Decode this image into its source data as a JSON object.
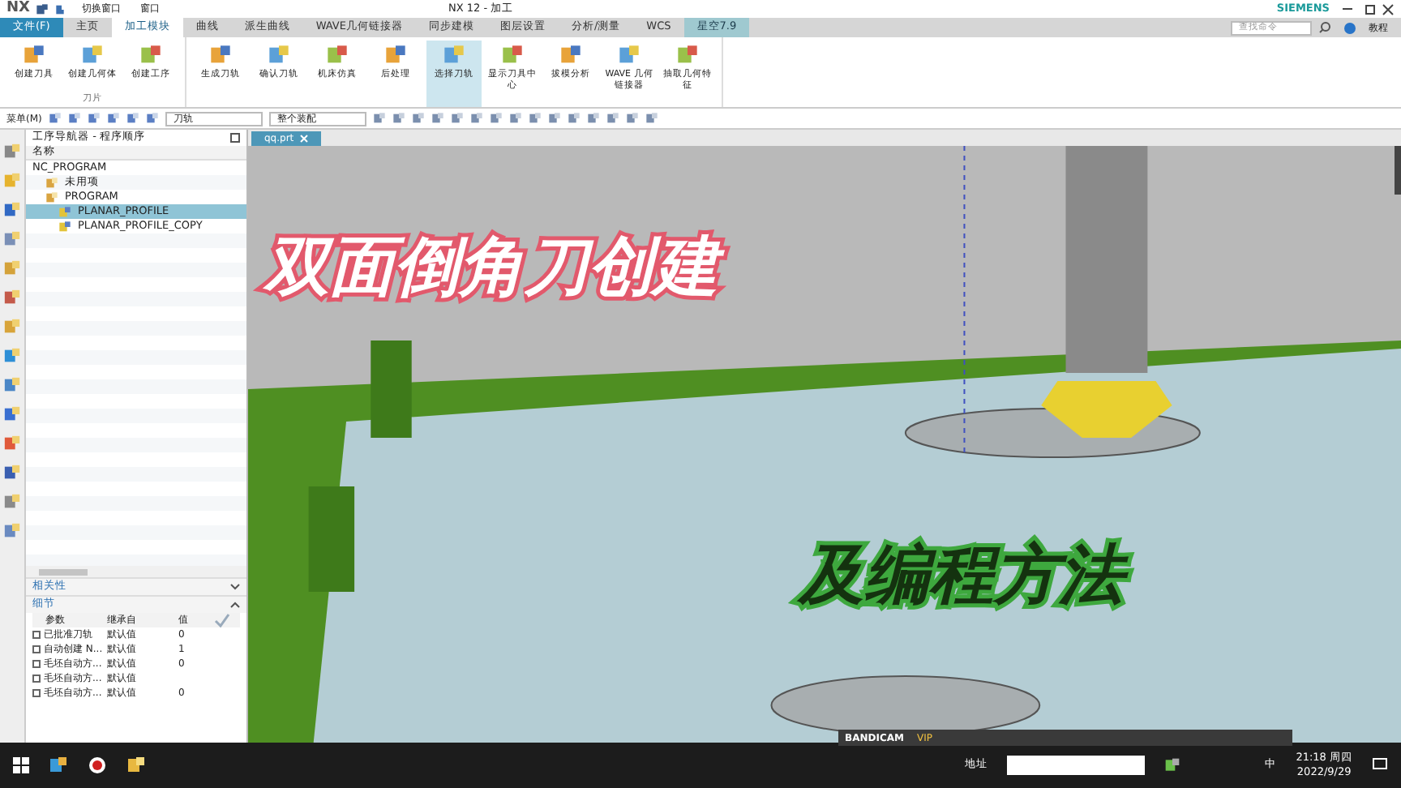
{
  "title_bar": {
    "app": "NX",
    "quick_access": [
      "切换窗口",
      "窗口"
    ],
    "title": "NX 12 - 加工",
    "brand": "SIEMENS"
  },
  "ribbon_tabs": [
    {
      "label": "文件(F)",
      "kind": "file",
      "selected": false
    },
    {
      "label": "主页",
      "kind": "tab",
      "selected": false
    },
    {
      "label": "加工模块",
      "kind": "tab",
      "selected": true
    },
    {
      "label": "曲线",
      "kind": "tab",
      "selected": false
    },
    {
      "label": "派生曲线",
      "kind": "tab",
      "selected": false
    },
    {
      "label": "WAVE几何链接器",
      "kind": "tab",
      "selected": false
    },
    {
      "label": "同步建模",
      "kind": "tab",
      "selected": false
    },
    {
      "label": "图层设置",
      "kind": "tab",
      "selected": false
    },
    {
      "label": "分析/测量",
      "kind": "tab",
      "selected": false
    },
    {
      "label": "WCS",
      "kind": "tab",
      "selected": false
    },
    {
      "label": "星空7.9",
      "kind": "plugin",
      "selected": false
    }
  ],
  "command_search": {
    "placeholder": "查找命令"
  },
  "help_label": "教程",
  "ribbon_groups": [
    {
      "label": "刀片",
      "buttons": [
        {
          "label": "创建刀具",
          "selected": false
        },
        {
          "label": "创建几何体",
          "selected": false
        },
        {
          "label": "创建工序",
          "selected": false
        }
      ]
    },
    {
      "buttons": [
        {
          "label": "生成刀轨",
          "selected": false
        },
        {
          "label": "确认刀轨",
          "selected": false
        },
        {
          "label": "机床仿真",
          "selected": false
        },
        {
          "label": "后处理",
          "selected": false
        },
        {
          "label": "选择刀轨",
          "selected": true
        },
        {
          "label": "显示刀具中心",
          "selected": false
        },
        {
          "label": "拔模分析",
          "selected": false
        },
        {
          "label": "WAVE 几何链接器",
          "selected": false
        },
        {
          "label": "抽取几何特征",
          "selected": false
        }
      ]
    }
  ],
  "toolbar": {
    "menu": "菜单(M)",
    "filter": "刀轨",
    "scope": "整个装配"
  },
  "navigator": {
    "title": "工序导航器 - 程序顺序",
    "column": "名称",
    "tree": [
      {
        "label": "NC_PROGRAM",
        "selected": false,
        "children": [
          {
            "label": "未用项",
            "kind": "group",
            "selected": false
          },
          {
            "label": "PROGRAM",
            "kind": "group",
            "selected": false,
            "children": [
              {
                "label": "PLANAR_PROFILE",
                "kind": "operation",
                "selected": true
              },
              {
                "label": "PLANAR_PROFILE_COPY",
                "kind": "operation",
                "selected": false
              }
            ]
          }
        ]
      }
    ]
  },
  "panels": [
    {
      "label": "相关性",
      "expanded": false
    },
    {
      "label": "细节",
      "expanded": true
    }
  ],
  "details": {
    "columns": [
      "参数",
      "继承自",
      "值"
    ],
    "rows": [
      {
        "param": "已批准刀轨",
        "from": "默认值",
        "value": "0"
      },
      {
        "param": "自动创建 N...",
        "from": "默认值",
        "value": "1"
      },
      {
        "param": "毛坯自动方...",
        "from": "默认值",
        "value": "0"
      },
      {
        "param": "毛坯自动方...",
        "from": "默认值"
      },
      {
        "param": "毛坯自动方...",
        "from": "默认值",
        "value": "0"
      }
    ]
  },
  "viewport": {
    "tab": "qq.prt",
    "overlay_titles": [
      {
        "text": "双面倒角刀创建",
        "kind": "pink"
      },
      {
        "text": "及编程方法",
        "kind": "green"
      }
    ]
  },
  "recorder": {
    "brand": "BANDICAM",
    "badge": "VIP"
  },
  "taskbar": {
    "address_label": "地址",
    "ime": "中",
    "time": "21:18 周四",
    "date": "2022/9/29"
  }
}
